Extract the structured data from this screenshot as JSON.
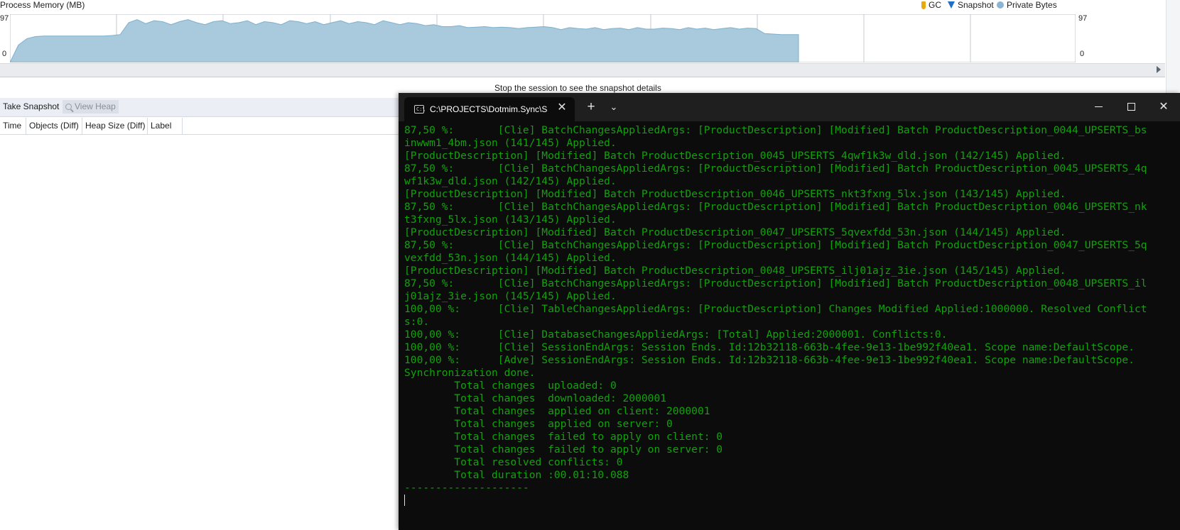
{
  "memory_chart": {
    "title": "Process Memory (MB)",
    "legend": [
      {
        "icon": "gc-icon",
        "label": "GC"
      },
      {
        "icon": "snapshot-icon",
        "label": "Snapshot"
      },
      {
        "icon": "private-bytes-icon",
        "label": "Private Bytes"
      }
    ],
    "y_max_left": "97",
    "y_min_left": "0",
    "y_max_right": "97",
    "y_min_right": "0",
    "fill_color": "#a9c9dc",
    "stroke_color": "#7fb0cc",
    "chart_data": {
      "type": "area",
      "title": "Process Memory (MB)",
      "series": [
        {
          "name": "Private Bytes",
          "color": "#a9c9dc",
          "values": [
            0,
            35,
            48,
            52,
            53,
            53,
            53,
            53,
            53,
            53,
            53,
            53,
            54,
            56,
            80,
            86,
            78,
            84,
            82,
            76,
            82,
            86,
            80,
            76,
            82,
            84,
            78,
            80,
            84,
            76,
            82,
            80,
            76,
            84,
            82,
            78,
            82,
            76,
            80,
            84,
            78,
            82,
            80,
            76,
            84,
            80,
            76,
            80,
            78,
            74,
            76,
            72,
            72,
            74,
            70,
            71,
            72,
            70,
            71,
            70,
            68,
            70,
            71,
            72,
            70,
            66,
            70,
            68,
            67,
            70,
            66,
            68,
            69,
            66,
            70,
            67,
            67,
            69,
            68,
            66,
            70,
            67,
            69,
            66,
            68,
            70,
            67,
            69,
            68,
            58,
            57,
            56,
            56,
            56
          ]
        }
      ],
      "ylim": [
        0,
        97
      ],
      "grid": true
    }
  },
  "status_message": "Stop the session to see the snapshot details",
  "toolbar": {
    "take_snapshot": "Take Snapshot",
    "view_heap": "View Heap"
  },
  "columns": [
    "Time",
    "Objects (Diff)",
    "Heap Size (Diff)",
    "Label"
  ],
  "terminal": {
    "tab_title": "C:\\PROJECTS\\Dotmim.Sync\\Samples\\",
    "tab_icon_text": "C:\\",
    "new_tab": "+",
    "dropdown": "⌄",
    "close_tab": "✕",
    "close_window": "✕",
    "lines": [
      "87,50 %:       [Clie] BatchChangesAppliedArgs: [ProductDescription] [Modified] Batch ProductDescription_0044_UPSERTS_bs",
      "inwwm1_4bm.json (141/145) Applied.",
      "[ProductDescription] [Modified] Batch ProductDescription_0045_UPSERTS_4qwf1k3w_dld.json (142/145) Applied.",
      "87,50 %:       [Clie] BatchChangesAppliedArgs: [ProductDescription] [Modified] Batch ProductDescription_0045_UPSERTS_4q",
      "wf1k3w_dld.json (142/145) Applied.",
      "[ProductDescription] [Modified] Batch ProductDescription_0046_UPSERTS_nkt3fxng_5lx.json (143/145) Applied.",
      "87,50 %:       [Clie] BatchChangesAppliedArgs: [ProductDescription] [Modified] Batch ProductDescription_0046_UPSERTS_nk",
      "t3fxng_5lx.json (143/145) Applied.",
      "[ProductDescription] [Modified] Batch ProductDescription_0047_UPSERTS_5qvexfdd_53n.json (144/145) Applied.",
      "87,50 %:       [Clie] BatchChangesAppliedArgs: [ProductDescription] [Modified] Batch ProductDescription_0047_UPSERTS_5q",
      "vexfdd_53n.json (144/145) Applied.",
      "[ProductDescription] [Modified] Batch ProductDescription_0048_UPSERTS_ilj01ajz_3ie.json (145/145) Applied.",
      "87,50 %:       [Clie] BatchChangesAppliedArgs: [ProductDescription] [Modified] Batch ProductDescription_0048_UPSERTS_il",
      "j01ajz_3ie.json (145/145) Applied.",
      "100,00 %:      [Clie] TableChangesAppliedArgs: [ProductDescription] Changes Modified Applied:1000000. Resolved Conflict",
      "s:0.",
      "100,00 %:      [Clie] DatabaseChangesAppliedArgs: [Total] Applied:2000001. Conflicts:0.",
      "100,00 %:      [Clie] SessionEndArgs: Session Ends. Id:12b32118-663b-4fee-9e13-1be992f40ea1. Scope name:DefaultScope.",
      "100,00 %:      [Adve] SessionEndArgs: Session Ends. Id:12b32118-663b-4fee-9e13-1be992f40ea1. Scope name:DefaultScope.",
      "Synchronization done.",
      "        Total changes  uploaded: 0",
      "        Total changes  downloaded: 2000001",
      "        Total changes  applied on client: 2000001",
      "        Total changes  applied on server: 0",
      "        Total changes  failed to apply on client: 0",
      "        Total changes  failed to apply on server: 0",
      "        Total resolved conflicts: 0",
      "        Total duration :00.01:10.088",
      "--------------------"
    ]
  }
}
